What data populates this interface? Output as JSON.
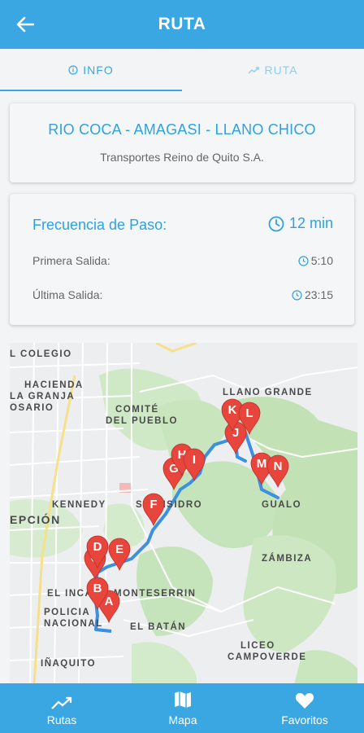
{
  "header": {
    "title": "RUTA"
  },
  "tabs": [
    {
      "label": "INFO",
      "icon": "info-icon",
      "active": true
    },
    {
      "label": "RUTA",
      "icon": "trending-icon",
      "active": false
    }
  ],
  "route": {
    "name": "RIO COCA - AMAGASI - LLANO CHICO",
    "company": "Transportes Reino de Quito S.A."
  },
  "schedule": {
    "frequency_label": "Frecuencia de Paso:",
    "frequency_value": "12 min",
    "first_label": "Primera Salida:",
    "first_value": "5:10",
    "last_label": "Última Salida:",
    "last_value": "23:15"
  },
  "map": {
    "labels": {
      "colegio": "L COLEGIO",
      "hacienda1": "HACIENDA",
      "hacienda2": "LA GRANJA",
      "osario": "OSARIO",
      "comite1": "COMITÉ",
      "comite2": "DEL PUEBLO",
      "llano_grande": "LLANO GRANDE",
      "kennedy": "KENNEDY",
      "san_isidro": "SAN ISIDRO",
      "gualo": "GUALO",
      "epcion": "EPCIÓN",
      "zambiza": "ZÁMBIZA",
      "el_inca": "EL INCA",
      "monteserrin": "MONTESERRIN",
      "policia1": "POLICIA",
      "policia2": "NACIONAL",
      "el_batan": "EL BATÁN",
      "liceo1": "LICEO",
      "liceo2": "CAMPOVERDE",
      "inaquito": "IÑAQUITO"
    },
    "stops": [
      "A",
      "B",
      "C",
      "D",
      "E",
      "F",
      "G",
      "H",
      "I",
      "J",
      "K",
      "L",
      "M",
      "N"
    ],
    "route_color": "#3d8fe0",
    "marker_color": "#e8453c"
  },
  "bottom_nav": [
    {
      "label": "Rutas",
      "icon": "trending-icon"
    },
    {
      "label": "Mapa",
      "icon": "map-icon"
    },
    {
      "label": "Favoritos",
      "icon": "heart-icon"
    }
  ],
  "colors": {
    "primary": "#3aa7e3",
    "accent_text": "#2ea2df",
    "background": "#f2f4f5"
  }
}
